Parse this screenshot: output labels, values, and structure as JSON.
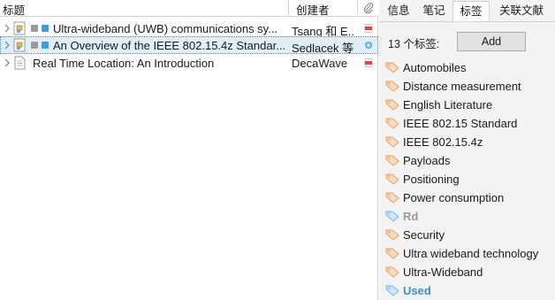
{
  "columns": {
    "title": "标题",
    "creator": "创建者"
  },
  "items": [
    {
      "title": "Ultra-wideband (UWB) communications sy...",
      "creator": "Tsang 和 E...",
      "attachment": "pdf-icon"
    },
    {
      "title": "An Overview of the IEEE 802.15.4z Standar...",
      "creator": "Sedlacek 等",
      "attachment": "web-link-icon"
    },
    {
      "title": "Real Time Location: An Introduction",
      "creator": "DecaWave",
      "attachment": "pdf-icon"
    }
  ],
  "tabs": [
    "信息",
    "笔记",
    "标签",
    "关联文献"
  ],
  "tags_panel": {
    "count_label": "13 个标签:",
    "add_label": "Add",
    "tags": [
      "Automobiles",
      "Distance measurement",
      "English Literature",
      "IEEE 802.15 Standard",
      "IEEE 802.15.4z",
      "Payloads",
      "Positioning",
      "Power consumption",
      "Rd",
      "Security",
      "Ultra wideband technology",
      "Ultra-Wideband",
      "Used"
    ]
  },
  "colors": {
    "tag_orange": "#e8a05f",
    "tag_blue": "#7fb6e3",
    "selected_row": "#e0eefa",
    "used_tag_text": "#3b8fd0",
    "muted_tag_text": "#9a9a9a"
  }
}
